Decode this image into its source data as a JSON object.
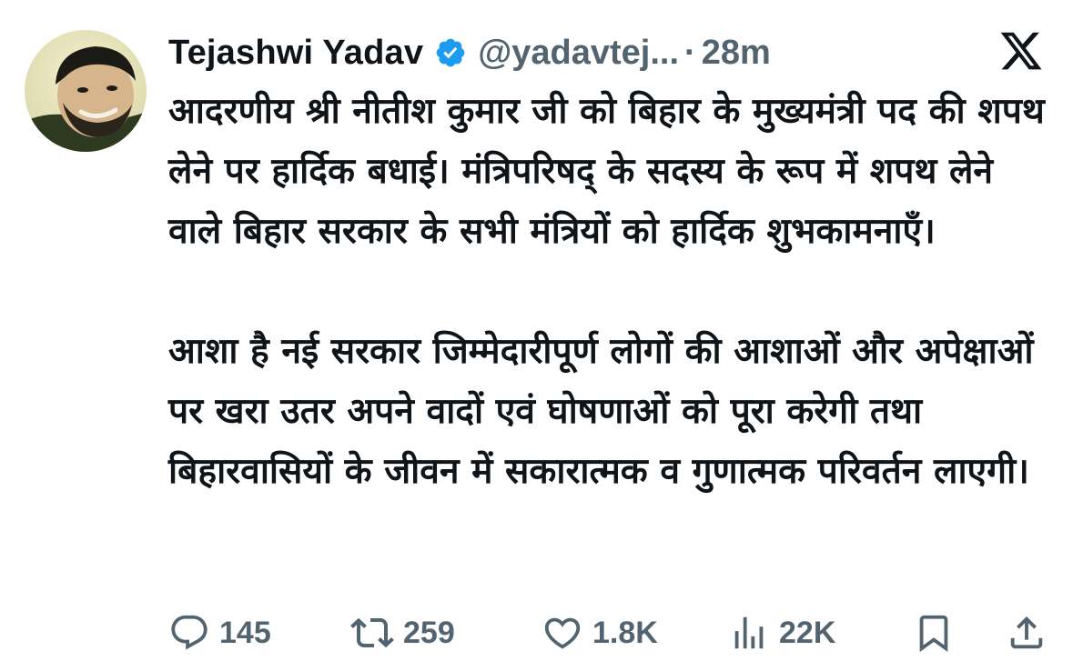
{
  "tweet": {
    "author_name": "Tejashwi Yadav",
    "handle": "@yadavtej...",
    "separator": "·",
    "time": "28m",
    "verified_color": "#1d9bf0",
    "paragraphs": [
      "आदरणीय श्री नीतीश कुमार जी को बिहार के मुख्यमंत्री पद की शपथ लेने पर हार्दिक बधाई। मंत्रिपरिषद् के सदस्य के रूप में शपथ लेने वाले बिहार सरकार के सभी मंत्रियों को हार्दिक शुभकामनाएँ।",
      "आशा है नई सरकार जिम्मेदारीपूर्ण लोगों की आशाओं और अपेक्षाओं पर खरा उतर अपने वादों एवं घोषणाओं को पूरा करेगी तथा बिहारवासियों के जीवन में सकारात्मक व गुणात्मक परिवर्तन लाएगी।"
    ]
  },
  "actions": {
    "replies": "145",
    "retweets": "259",
    "likes": "1.8K",
    "views": "22K",
    "icons": [
      "reply-icon",
      "retweet-icon",
      "like-icon",
      "views-icon",
      "bookmark-icon",
      "share-icon"
    ]
  },
  "colors": {
    "text": "#0f1419",
    "muted": "#536471"
  }
}
